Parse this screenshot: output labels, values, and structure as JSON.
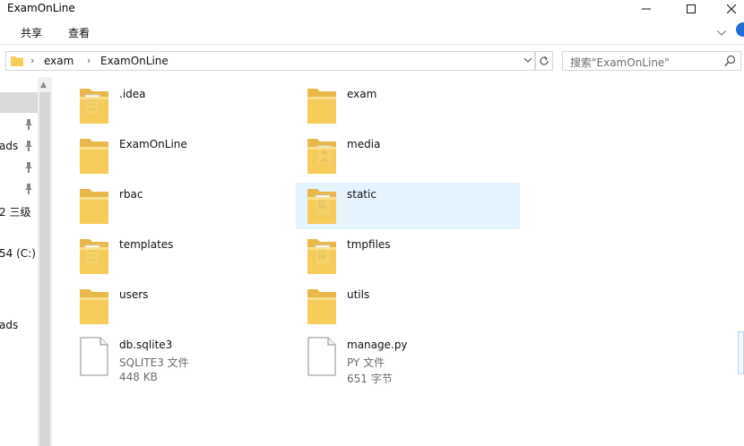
{
  "window": {
    "title": "ExamOnLine"
  },
  "ribbon": {
    "tabs": [
      {
        "label": "共享"
      },
      {
        "label": "查看"
      }
    ]
  },
  "address": {
    "breadcrumbs": [
      {
        "label": "exam"
      },
      {
        "label": "ExamOnLine"
      }
    ]
  },
  "search": {
    "placeholder": "搜索\"ExamOnLine\""
  },
  "nav": {
    "items": [
      {
        "label": "ads"
      },
      {
        "label": "2  三级"
      },
      {
        "label": "54 (C:)"
      },
      {
        "label": "ads"
      }
    ]
  },
  "files": [
    {
      "name": ".idea",
      "kind": "folder",
      "icon": "folder-with-pages-icon"
    },
    {
      "name": "exam",
      "kind": "folder",
      "icon": "folder-icon"
    },
    {
      "name": "ExamOnLine",
      "kind": "folder",
      "icon": "folder-icon"
    },
    {
      "name": "media",
      "kind": "folder",
      "icon": "folder-with-photo-icon"
    },
    {
      "name": "rbac",
      "kind": "folder",
      "icon": "folder-icon"
    },
    {
      "name": "static",
      "kind": "folder",
      "icon": "folder-with-document-icon",
      "selected": true
    },
    {
      "name": "templates",
      "kind": "folder",
      "icon": "folder-with-pages-icon"
    },
    {
      "name": "tmpfiles",
      "kind": "folder",
      "icon": "folder-with-document-icon"
    },
    {
      "name": "users",
      "kind": "folder",
      "icon": "folder-icon"
    },
    {
      "name": "utils",
      "kind": "folder",
      "icon": "folder-icon"
    },
    {
      "name": "db.sqlite3",
      "kind": "file",
      "type": "SQLITE3 文件",
      "size": "448 KB",
      "icon": "blank-file-icon"
    },
    {
      "name": "manage.py",
      "kind": "file",
      "type": "PY 文件",
      "size": "651 字节",
      "icon": "blank-file-icon"
    }
  ],
  "colors": {
    "selection": "#e5f3ff",
    "folder": "#f5cd5b",
    "accent": "#1e6fd9"
  }
}
